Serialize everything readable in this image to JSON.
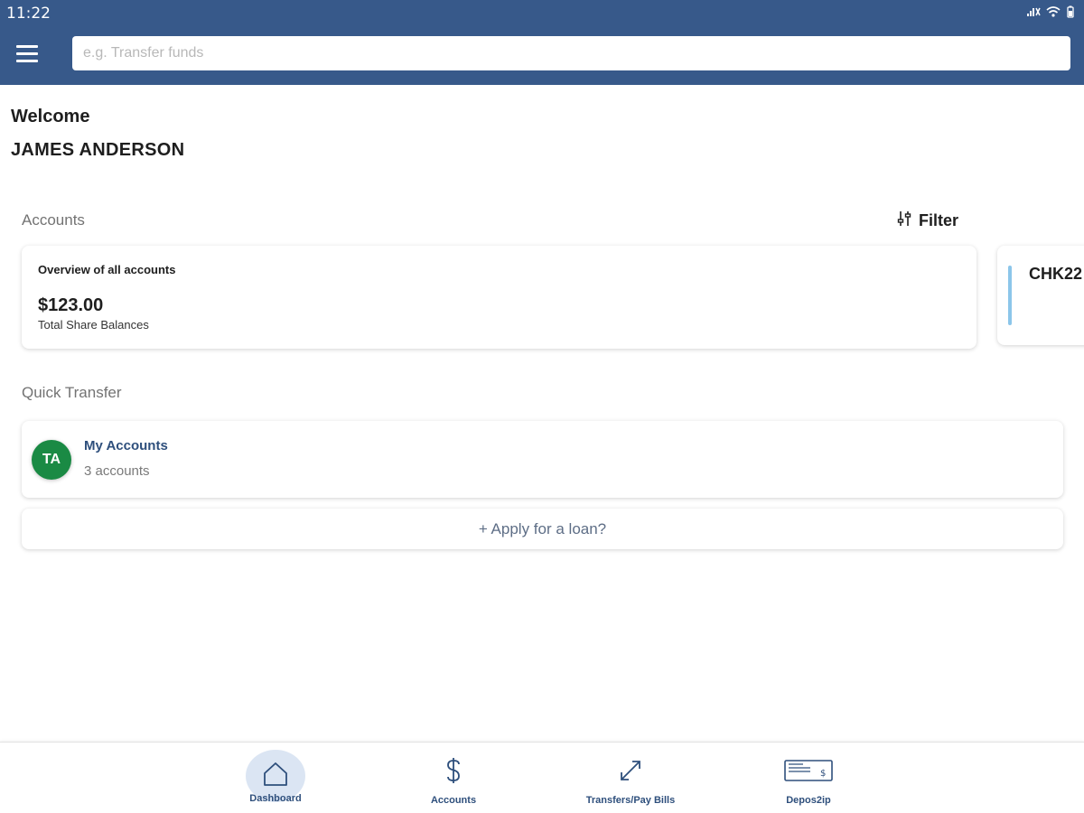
{
  "status_bar": {
    "time": "11:22"
  },
  "search": {
    "placeholder": "e.g. Transfer funds"
  },
  "welcome": {
    "greeting": "Welcome",
    "name": "JAMES ANDERSON"
  },
  "accounts_section": {
    "title": "Accounts",
    "filter_label": "Filter",
    "overview": {
      "title": "Overview of all accounts",
      "amount": "$123.00",
      "subtitle": "Total Share Balances"
    },
    "account_card": {
      "name": "CHK22"
    }
  },
  "quick_transfer": {
    "title": "Quick Transfer",
    "avatar_initials": "TA",
    "item_title": "My Accounts",
    "item_subtitle": "3 accounts",
    "loan_label": "+ Apply for a loan?"
  },
  "bottom_nav": {
    "items": [
      {
        "label": "Dashboard",
        "icon": "home-icon",
        "active": true
      },
      {
        "label": "Accounts",
        "icon": "dollar-icon",
        "active": false
      },
      {
        "label": "Transfers/Pay Bills",
        "icon": "transfer-arrows-icon",
        "active": false
      },
      {
        "label": "Depos2ip",
        "icon": "check-deposit-icon",
        "active": false
      }
    ]
  },
  "colors": {
    "header": "#37598a",
    "avatar": "#1a8a44",
    "nav_active_bg": "#dbe5f3",
    "accent_line": "#8cc6ea"
  }
}
